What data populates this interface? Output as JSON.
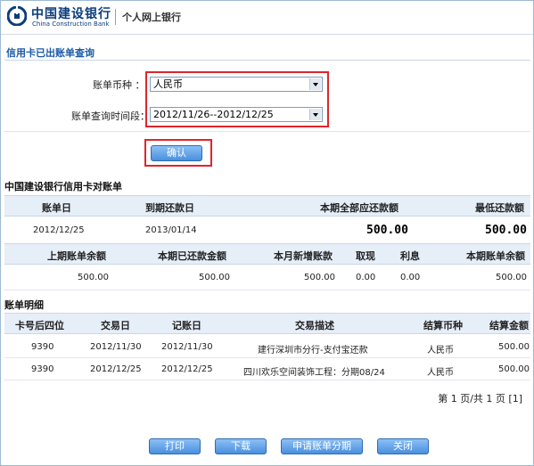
{
  "header": {
    "bank_cn": "中国建设银行",
    "bank_en": "China Construction Bank",
    "sub_title": "个人网上银行",
    "brand_color": "#0b3d7a"
  },
  "page": {
    "title": "信用卡已出账单查询"
  },
  "form": {
    "currency_label": "账单币种 ：",
    "currency_value": "人民币",
    "period_label": "账单查询时间段：",
    "period_value": "2012/11/26--2012/12/25",
    "confirm_label": "确认",
    "highlight_color": "#e0252b"
  },
  "statement": {
    "title": "中国建设银行信用卡对账单",
    "headers": [
      "账单日",
      "到期还款日",
      "本期全部应还款额",
      "最低还款额"
    ],
    "values": [
      "2012/12/25",
      "2013/01/14",
      "500.00",
      "500.00"
    ],
    "headers2": [
      "上期账单余额",
      "本期已还款金额",
      "本月新增账款",
      "取现",
      "利息",
      "本期账单余额"
    ],
    "values2": [
      "500.00",
      "500.00",
      "500.00",
      "0.00",
      "0.00",
      "500.00"
    ]
  },
  "details": {
    "title": "账单明细",
    "headers": [
      "卡号后四位",
      "交易日",
      "记账日",
      "交易描述",
      "结算币种",
      "结算金额"
    ],
    "rows": [
      [
        "9390",
        "2012/11/30",
        "2012/11/30",
        "建行深圳市分行-支付宝还款",
        "人民币",
        "500.00"
      ],
      [
        "9390",
        "2012/12/25",
        "2012/12/25",
        "四川欢乐空间装饰工程：分期08/24",
        "人民币",
        "500.00"
      ]
    ],
    "pager": "第 1 页/共 1 页 [1]"
  },
  "footer": {
    "print_label": "打印",
    "download_label": "下载",
    "installment_label": "申请账单分期",
    "close_label": "关闭"
  },
  "icons": {
    "logo": "ccb-logo-icon",
    "dropdown": "chevron-down-icon"
  }
}
